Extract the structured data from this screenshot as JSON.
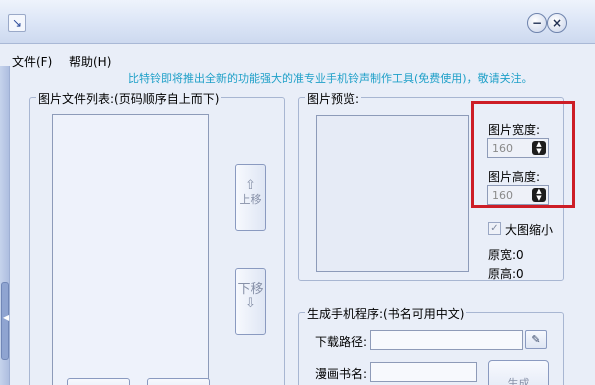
{
  "window": {
    "title": ""
  },
  "menu": {
    "file": "文件(F)",
    "help": "帮助(H)"
  },
  "tagline": "比特铃即将推出全新的功能强大的准专业手机铃声制作工具(免费使用)，敬请关注。",
  "image_list": {
    "title": "图片文件列表:(页码顺序自上而下)",
    "up_button": "上移",
    "down_button": "下移"
  },
  "preview": {
    "title": "图片预览:",
    "width_label": "图片宽度:",
    "width_value": "160",
    "height_label": "图片高度:",
    "height_value": "160",
    "shrink_label": "大图缩小",
    "shrink_checked": true,
    "orig_width": "原宽:0",
    "orig_height": "原高:0"
  },
  "generate": {
    "title": "生成手机程序:(书名可用中文)",
    "download_path_label": "下载路径:",
    "book_name_label": "漫画书名:",
    "generate_button": "生成"
  },
  "colors": {
    "highlight": "#cd1d26",
    "tagline": "#1fa0c8"
  }
}
